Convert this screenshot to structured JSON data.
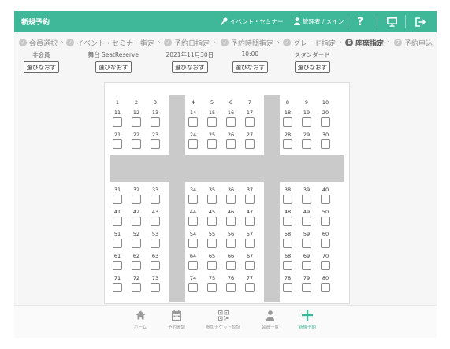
{
  "header": {
    "title": "新規予約",
    "event_label": "イベント・セミナー",
    "user_label": "管理者 / メイン",
    "help_glyph": "?",
    "icons": [
      "mic-icon",
      "user-icon",
      "help-icon",
      "monitor-icon",
      "logout-icon"
    ],
    "color": "#3fb89a"
  },
  "steps": [
    {
      "num": "✓",
      "label": "会員選択",
      "value": "非会員",
      "button": "選びなおす",
      "status": "done"
    },
    {
      "num": "✓",
      "label": "イベント・セミナー指定",
      "value": "舞台 SeatReserve",
      "button": "選びなおす",
      "status": "done"
    },
    {
      "num": "✓",
      "label": "予約日指定",
      "value": "2021年11月30日",
      "button": "選びなおす",
      "status": "done"
    },
    {
      "num": "✓",
      "label": "予約時間指定",
      "value": "10:00",
      "button": "選びなおす",
      "status": "done"
    },
    {
      "num": "✓",
      "label": "グレード指定",
      "value": "スタンダード",
      "button": "選びなおす",
      "status": "done"
    },
    {
      "num": "6",
      "label": "座席指定",
      "value": "",
      "button": "",
      "status": "active"
    },
    {
      "num": "7",
      "label": "予約申込",
      "value": "",
      "button": "",
      "status": "pending"
    }
  ],
  "seats": {
    "top_labels": [
      "1",
      "2",
      "3",
      "4",
      "5",
      "6",
      "7",
      "8",
      "9",
      "10"
    ],
    "rows": [
      [
        "11",
        "12",
        "13",
        "14",
        "15",
        "16",
        "17",
        "18",
        "19",
        "20"
      ],
      [
        "21",
        "22",
        "23",
        "24",
        "25",
        "26",
        "27",
        "28",
        "29",
        "30"
      ],
      [
        "31",
        "32",
        "33",
        "34",
        "35",
        "36",
        "37",
        "38",
        "39",
        "40"
      ],
      [
        "41",
        "42",
        "43",
        "44",
        "45",
        "46",
        "47",
        "48",
        "49",
        "50"
      ],
      [
        "51",
        "52",
        "53",
        "54",
        "55",
        "56",
        "57",
        "58",
        "59",
        "60"
      ],
      [
        "61",
        "62",
        "63",
        "64",
        "65",
        "66",
        "67",
        "68",
        "69",
        "70"
      ],
      [
        "71",
        "72",
        "73",
        "74",
        "75",
        "76",
        "77",
        "78",
        "79",
        "80"
      ]
    ]
  },
  "bottom_nav": [
    {
      "label": "ホーム",
      "icon": "home-icon",
      "active": false
    },
    {
      "label": "予約確認",
      "icon": "calendar-icon",
      "active": false
    },
    {
      "label": "参加チケット認証",
      "icon": "qr-code-icon",
      "active": false
    },
    {
      "label": "会員一覧",
      "icon": "person-icon",
      "active": false
    },
    {
      "label": "新規予約",
      "icon": "plus-icon",
      "active": true
    }
  ]
}
